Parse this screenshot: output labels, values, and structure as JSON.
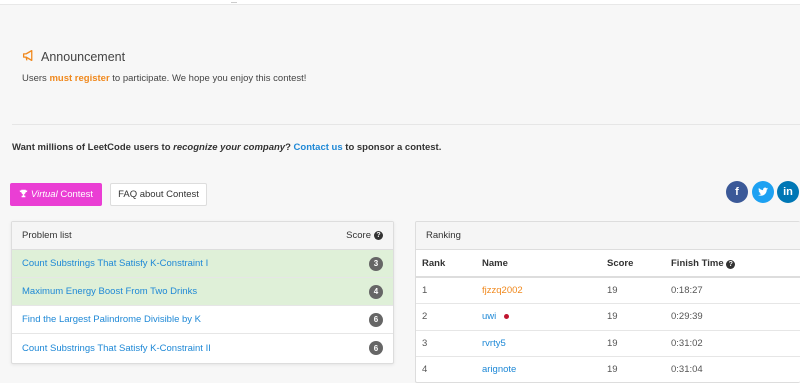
{
  "announcement": {
    "title": "Announcement",
    "text_pre": "Users ",
    "text_highlight": "must register",
    "text_post": " to participate. We hope you enjoy this contest!"
  },
  "sponsor": {
    "pre": "Want millions of LeetCode users to ",
    "em": "recognize your company",
    "mid": "? ",
    "link": "Contact us",
    "post": " to sponsor a contest."
  },
  "buttons": {
    "virtual_em": "Virtual",
    "virtual_rest": " Contest",
    "faq": "FAQ about Contest"
  },
  "social": {
    "facebook": "f",
    "linkedin": "in"
  },
  "problem_list": {
    "header": "Problem list",
    "score_header": "Score",
    "problems": [
      {
        "title": "Count Substrings That Satisfy K-Constraint I",
        "score": "3",
        "solved": true
      },
      {
        "title": "Maximum Energy Boost From Two Drinks",
        "score": "4",
        "solved": true
      },
      {
        "title": "Find the Largest Palindrome Divisible by K",
        "score": "6",
        "solved": false
      },
      {
        "title": "Count Substrings That Satisfy K-Constraint II",
        "score": "6",
        "solved": false
      }
    ]
  },
  "ranking": {
    "header": "Ranking",
    "columns": [
      "Rank",
      "Name",
      "Score",
      "Finish Time"
    ],
    "rows": [
      {
        "rank": "1",
        "name": "fjzzq2002",
        "score": "19",
        "time": "0:18:27"
      },
      {
        "rank": "2",
        "name": "uwi",
        "score": "19",
        "time": "0:29:39"
      },
      {
        "rank": "3",
        "name": "rvrty5",
        "score": "19",
        "time": "0:31:02"
      },
      {
        "rank": "4",
        "name": "arignote",
        "score": "19",
        "time": "0:31:04"
      }
    ]
  },
  "colors": {
    "accent_orange": "#f0891e",
    "link_blue": "#1e88d6",
    "virtual_button": "#ea3ed4",
    "solved_row": "#dff0d8"
  }
}
